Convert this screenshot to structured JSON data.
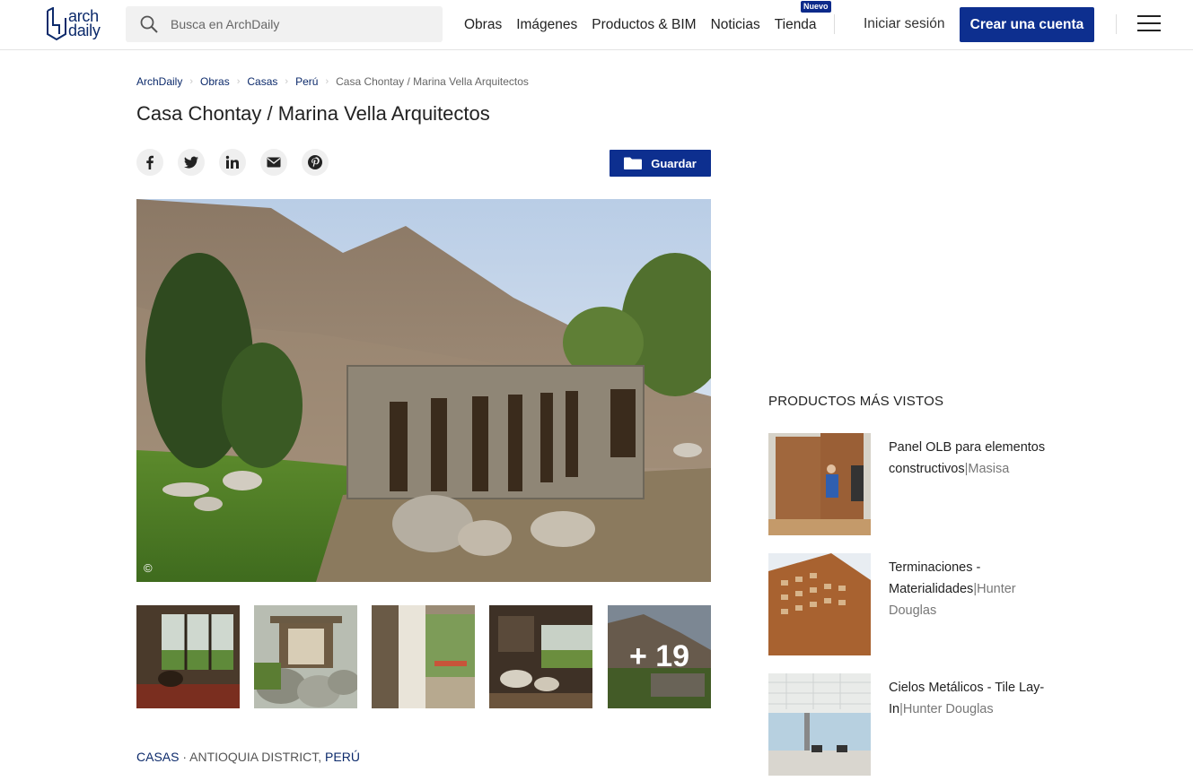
{
  "header": {
    "logo_line1": "arch",
    "logo_line2": "daily",
    "search_placeholder": "Busca en ArchDaily",
    "nav": [
      "Obras",
      "Imágenes",
      "Productos & BIM",
      "Noticias",
      "Tienda"
    ],
    "shop_badge": "Nuevo",
    "login": "Iniciar sesión",
    "signup": "Crear una cuenta"
  },
  "breadcrumb": [
    "ArchDaily",
    "Obras",
    "Casas",
    "Perú",
    "Casa Chontay / Marina Vella Arquitectos"
  ],
  "title": "Casa Chontay / Marina Vella Arquitectos",
  "share_icons": [
    "facebook-icon",
    "twitter-icon",
    "linkedin-icon",
    "email-icon",
    "pinterest-icon"
  ],
  "save_label": "Guardar",
  "hero_copyright": "©",
  "more_photos": "+ 19",
  "tags": {
    "category": "CASAS",
    "dot": " · ",
    "district": "ANTIOQUIA DISTRICT",
    "comma": ", ",
    "country": "PERÚ"
  },
  "sidebar": {
    "title": "PRODUCTOS MÁS VISTOS",
    "products": [
      {
        "name": "Panel OLB para elementos constructivos",
        "sep": "|",
        "brand": "Masisa"
      },
      {
        "name": "Terminaciones - Materialidades",
        "sep": "|",
        "brand": "Hunter Douglas"
      },
      {
        "name": "Cielos Metálicos - Tile Lay-In",
        "sep": "|",
        "brand": "Hunter Douglas"
      }
    ]
  },
  "colors": {
    "brand_blue": "#0d2f8f",
    "link_blue": "#0c2a6b"
  }
}
